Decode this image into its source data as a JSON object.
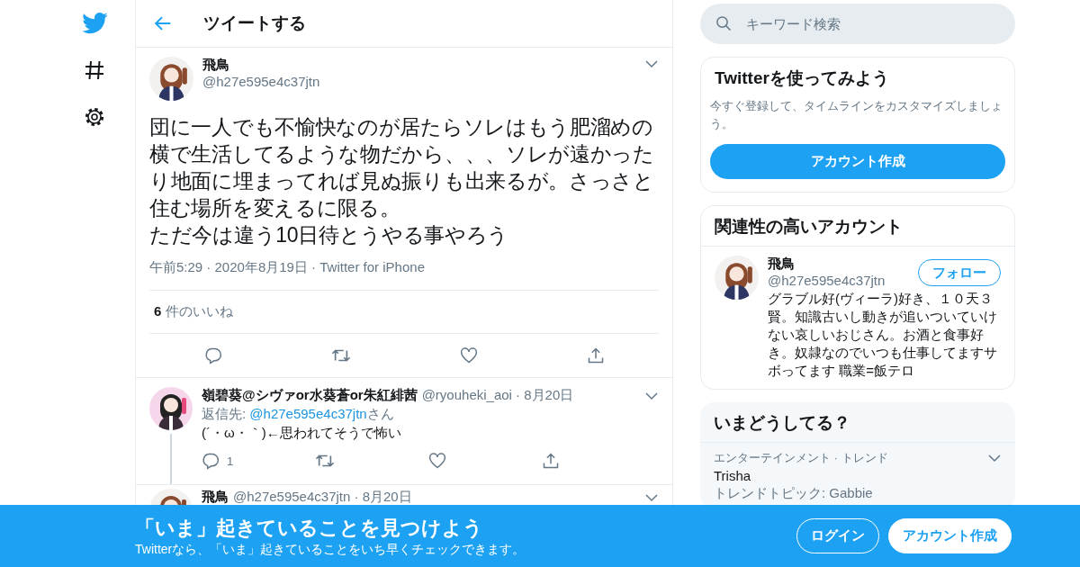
{
  "header": {
    "title": "ツイートする"
  },
  "tweet": {
    "author": {
      "name": "飛鳥",
      "handle": "@h27e595e4c37jtn"
    },
    "text": [
      "団に一人でも不愉快なのが居たらソレはもう肥溜めの横で生活してるような物だから、、、ソレが遠かったり地面に埋まってれば見ぬ振りも出来るが。さっさと住む場所を変えるに限る。",
      "ただ今は違う10日待とうやる事やろう"
    ],
    "meta": "午前5:29 · 2020年8月19日 · Twitter for iPhone",
    "likes": "**6** 件のいいね"
  },
  "replies": [
    {
      "name": "嶺碧葵@シヴァor水葵蒼or朱紅緋茜",
      "meta": "@ryouheki_aoi · 8月20日",
      "reply_to": {
        "prefix": "返信先: ",
        "handle": "@h27e595e4c37jtn",
        "suffix": "さん"
      },
      "text": "(´・ω・｀)←思われてそうで怖い",
      "reply_count": "1",
      "threaded": true
    },
    {
      "name": "飛鳥",
      "meta": "@h27e595e4c37jtn · 8月20日",
      "threaded": false
    }
  ],
  "search": {
    "placeholder": "キーワード検索"
  },
  "signup_card": {
    "title": "Twitterを使ってみよう",
    "text": "今すぐ登録して、タイムラインをカスタマイズしましょう。",
    "button": "アカウント作成"
  },
  "related": {
    "title": "関連性の高いアカウント",
    "accounts": [
      {
        "name": "飛鳥",
        "handle": "@h27e595e4c37jtn",
        "bio": "グラブル好(ヴィーラ)好き、１０天３賢。知識古いし動きが追いついていけない哀しいおじさん。お酒と食事好き。奴隷なのでいつも仕事してますサボってます 職業=飯テロ",
        "follow": "フォロー"
      }
    ]
  },
  "trends": {
    "title": "いまどうしてる？",
    "items": [
      {
        "category": "エンターテインメント · トレンド",
        "name": "Trisha",
        "detail": "トレンドトピック: Gabbie"
      }
    ]
  },
  "banner": {
    "title": "「いま」起きていることを見つけよう",
    "subtitle": "Twitterなら、「いま」起きていることをいち早くチェックできます。",
    "login": "ログイン",
    "signup": "アカウント作成"
  }
}
